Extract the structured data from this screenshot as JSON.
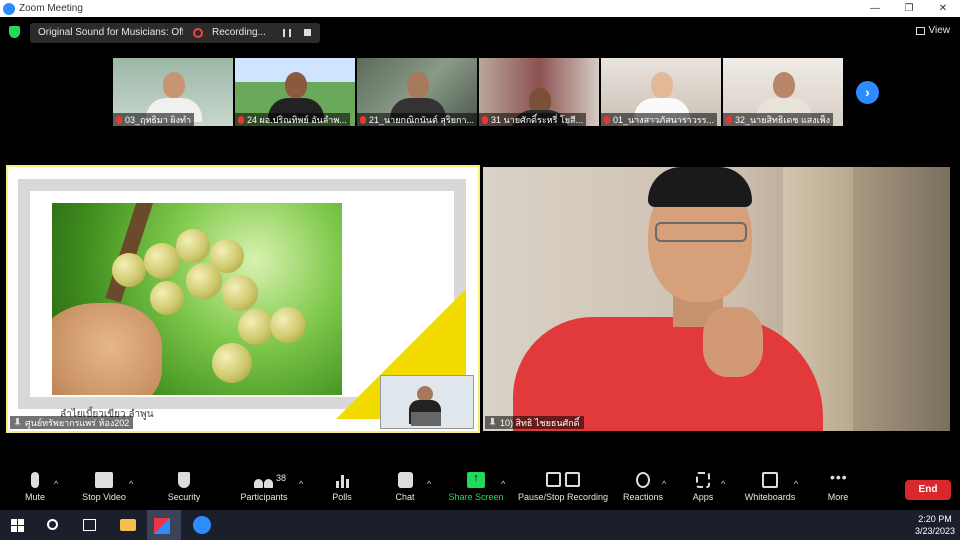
{
  "window": {
    "title": "Zoom Meeting",
    "controls": [
      "—",
      "❐",
      "✕"
    ]
  },
  "topbar": {
    "sound_label": "Original Sound for Musicians: Off",
    "recording_label": "Recording...",
    "view_label": "View"
  },
  "participants_strip": [
    {
      "name": "03_ฤทธิมา ผิงทำ"
    },
    {
      "name": "24 ผอ.ปริณทิพย์ อันลำพ..."
    },
    {
      "name": "21_นายกณิกนันต์ สุริยกา..."
    },
    {
      "name": "31 นายศักดิ์ระหรี่ โยสี..."
    },
    {
      "name": "01_นางสาวภัสนาราวรร..."
    },
    {
      "name": "32_นายสิทธิเดช แสงเพ็ง"
    }
  ],
  "share": {
    "caption": "ลำไยเบี้ยวเขียว ลำพูน",
    "presenter_label": "ศูนย์ทรัพยากรแพร่ ห้อง202"
  },
  "speaker": {
    "label": "10) สิทธิ ไชยธนศักดิ์"
  },
  "toolbar": {
    "mute": "Mute",
    "stop_video": "Stop Video",
    "security": "Security",
    "participants": "Participants",
    "participants_count": "38",
    "polls": "Polls",
    "chat": "Chat",
    "share_screen": "Share Screen",
    "pause_stop_recording": "Pause/Stop Recording",
    "reactions": "Reactions",
    "apps": "Apps",
    "whiteboards": "Whiteboards",
    "more": "More",
    "end": "End"
  },
  "taskbar": {
    "time": "2:20 PM",
    "date": "3/23/2023"
  },
  "colors": {
    "accent_blue": "#2d8cff",
    "share_green": "#23d959",
    "end_red": "#d9272e",
    "active_border": "#f5f27a"
  }
}
